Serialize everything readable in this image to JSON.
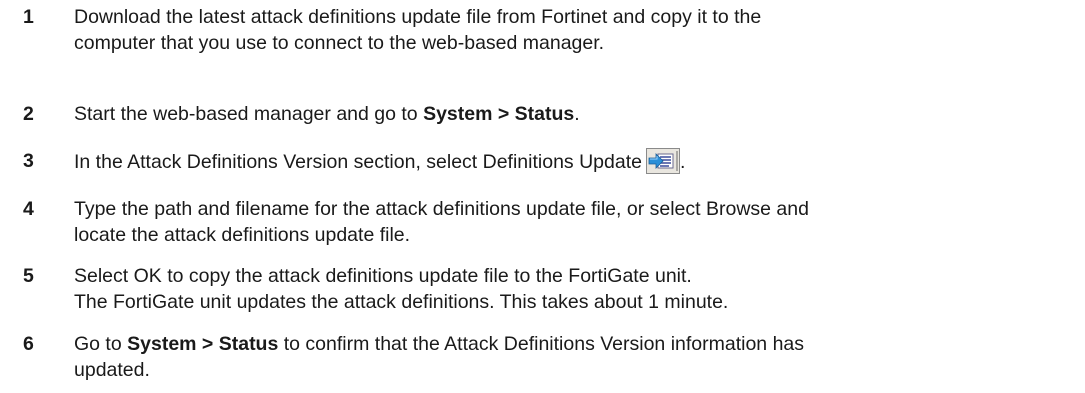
{
  "steps": [
    {
      "number": "1",
      "lines": [
        "Download the latest attack definitions update file from Fortinet and copy it to the",
        "computer that you use to connect to the web-based manager."
      ]
    },
    {
      "number": "2",
      "before": "Start the web-based manager and go to ",
      "bold": "System > Status",
      "after": "."
    },
    {
      "number": "3",
      "before": "In the Attack Definitions Version section, select Definitions Update",
      "icon": "definitions-update-icon",
      "after": "."
    },
    {
      "number": "4",
      "lines": [
        "Type the path and filename for the attack definitions update file, or select Browse and",
        "locate the attack definitions update file."
      ]
    },
    {
      "number": "5",
      "lines": [
        "Select OK to copy the attack definitions update file to the FortiGate unit.",
        "The FortiGate unit updates the attack definitions. This takes about 1 minute."
      ]
    },
    {
      "number": "6",
      "bold": "System > Status",
      "before": "Go to ",
      "after": " to confirm that the Attack Definitions Version information has",
      "line2": "updated."
    }
  ]
}
